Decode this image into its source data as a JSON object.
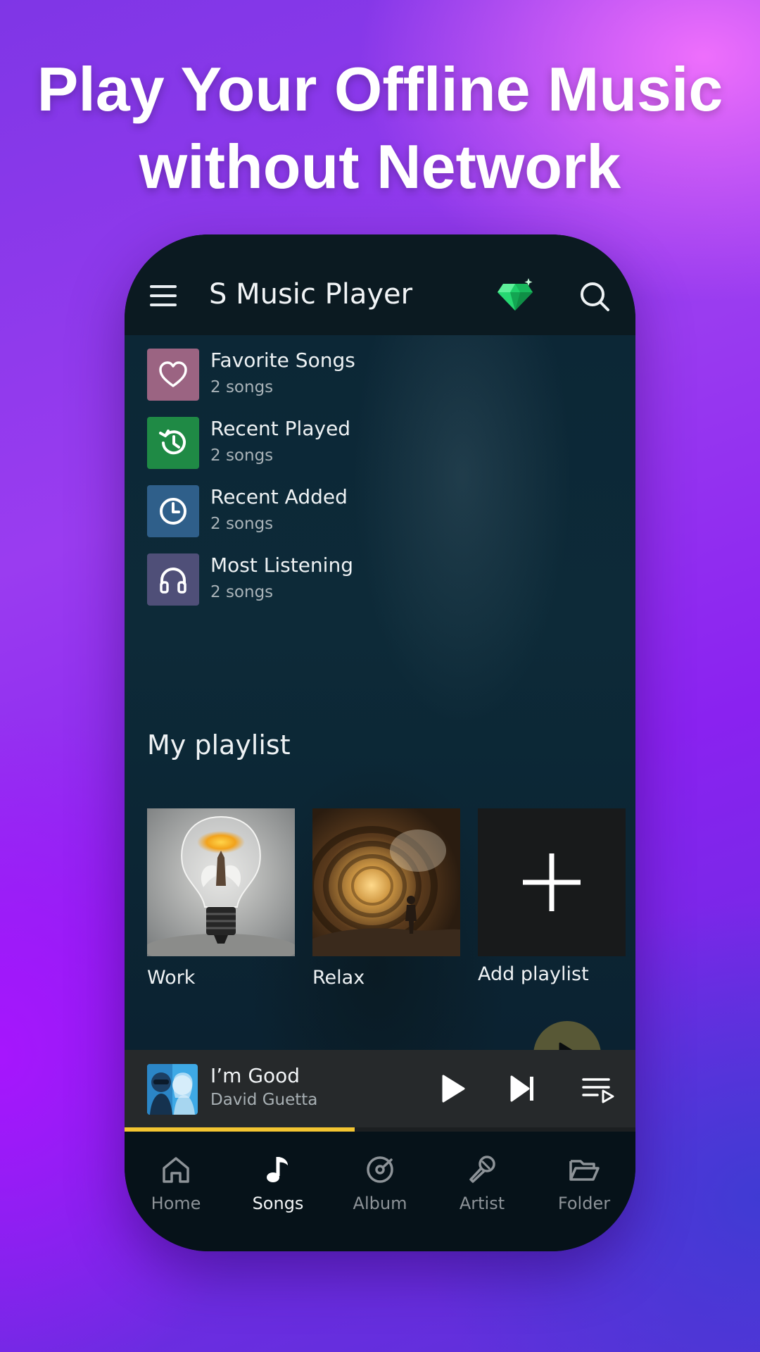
{
  "headline": {
    "line1": "Play Your Offline Music",
    "line2": "without Network"
  },
  "app": {
    "title": "S Music Player",
    "icons": {
      "menu": "hamburger-menu-icon",
      "premium": "diamond-icon",
      "search": "search-icon"
    }
  },
  "quick_lists": [
    {
      "title": "Favorite Songs",
      "subtitle": "2 songs",
      "icon": "heart-icon",
      "color": "#9b6482"
    },
    {
      "title": "Recent Played",
      "subtitle": "2 songs",
      "icon": "history-icon",
      "color": "#1f8a45"
    },
    {
      "title": "Recent Added",
      "subtitle": "2 songs",
      "icon": "clock-icon",
      "color": "#2f5f8a"
    },
    {
      "title": "Most Listening",
      "subtitle": "2 songs",
      "icon": "headphones-icon",
      "color": "#4f4f78"
    }
  ],
  "playlists": {
    "section_title": "My playlist",
    "items": [
      {
        "label": "Work",
        "art": "lightbulb-fairy-image"
      },
      {
        "label": "Relax",
        "art": "tunnel-silhouette-image"
      },
      {
        "label": "Add playlist",
        "art": "plus-icon"
      }
    ]
  },
  "now_playing": {
    "title": "I’m Good",
    "artist": "David Guetta",
    "progress": 0.45,
    "accent": "#f3c531"
  },
  "nav": {
    "items": [
      {
        "label": "Home",
        "icon": "home-icon",
        "active": false
      },
      {
        "label": "Songs",
        "icon": "music-note-icon",
        "active": true
      },
      {
        "label": "Album",
        "icon": "album-disc-icon",
        "active": false
      },
      {
        "label": "Artist",
        "icon": "microphone-icon",
        "active": false
      },
      {
        "label": "Folder",
        "icon": "folder-icon",
        "active": false
      }
    ]
  }
}
